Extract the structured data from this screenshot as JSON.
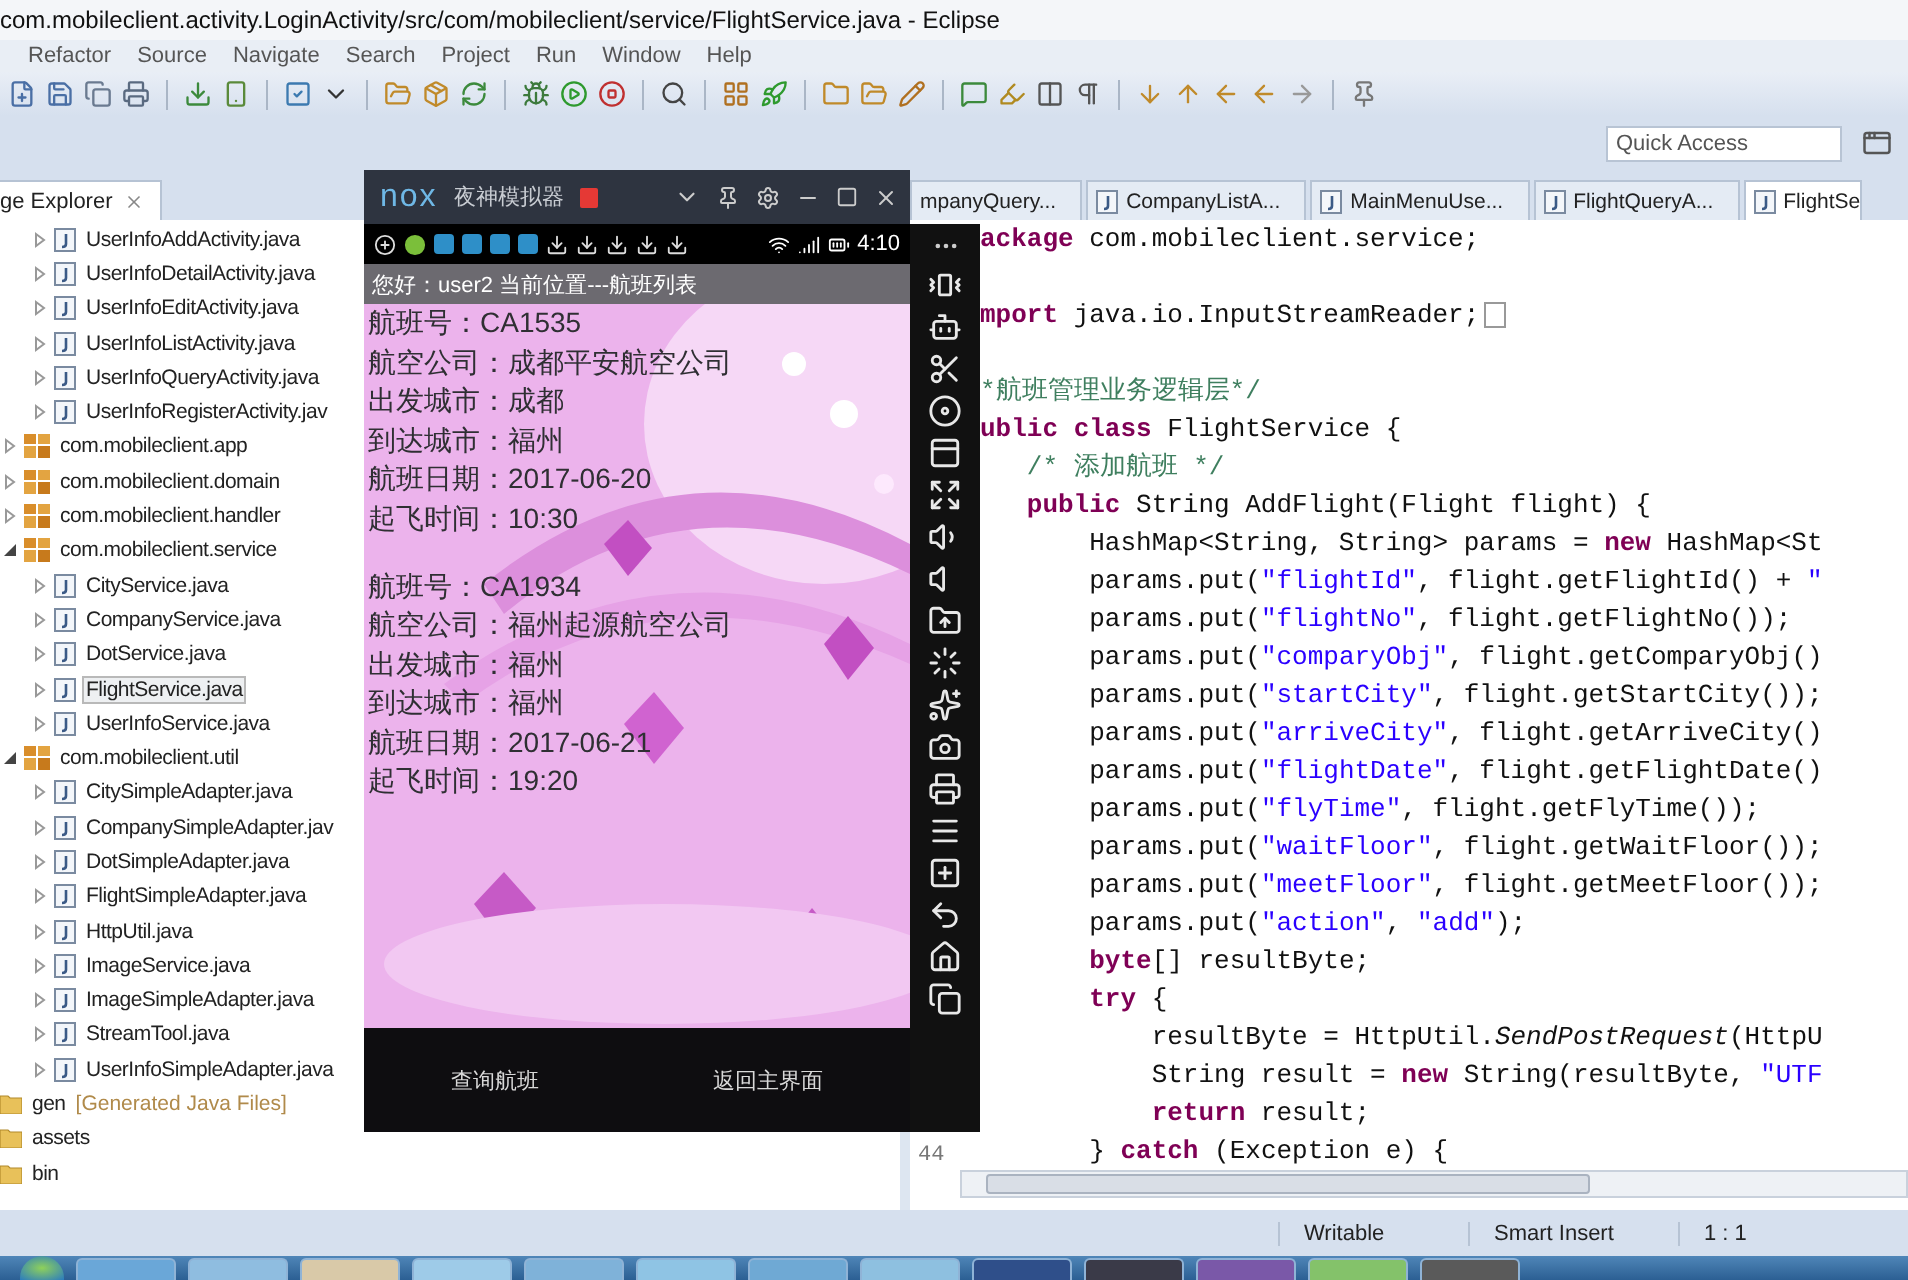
{
  "window": {
    "title": "com.mobileclient.activity.LoginActivity/src/com/mobileclient/service/FlightService.java - Eclipse"
  },
  "menu": [
    "Refactor",
    "Source",
    "Navigate",
    "Search",
    "Project",
    "Run",
    "Window",
    "Help"
  ],
  "quick_access": {
    "placeholder": "Quick Access"
  },
  "package_explorer": {
    "title": "ge Explorer",
    "tree": [
      {
        "label": "UserInfoAddActivity.java",
        "kind": "file",
        "selected": false
      },
      {
        "label": "UserInfoDetailActivity.java",
        "kind": "file",
        "selected": false
      },
      {
        "label": "UserInfoEditActivity.java",
        "kind": "file",
        "selected": false
      },
      {
        "label": "UserInfoListActivity.java",
        "kind": "file",
        "selected": false
      },
      {
        "label": "UserInfoQueryActivity.java",
        "kind": "file",
        "selected": false
      },
      {
        "label": "UserInfoRegisterActivity.jav",
        "kind": "file",
        "selected": false
      },
      {
        "label": "com.mobileclient.app",
        "kind": "package",
        "expanded": false,
        "selected": false
      },
      {
        "label": "com.mobileclient.domain",
        "kind": "package",
        "expanded": false,
        "selected": false
      },
      {
        "label": "com.mobileclient.handler",
        "kind": "package",
        "expanded": false,
        "selected": false
      },
      {
        "label": "com.mobileclient.service",
        "kind": "package",
        "expanded": true,
        "selected": false,
        "children": [
          {
            "label": "CityService.java",
            "kind": "file",
            "selected": false
          },
          {
            "label": "CompanyService.java",
            "kind": "file",
            "selected": false
          },
          {
            "label": "DotService.java",
            "kind": "file",
            "selected": false
          },
          {
            "label": "FlightService.java",
            "kind": "file",
            "selected": true
          },
          {
            "label": "UserInfoService.java",
            "kind": "file",
            "selected": false
          }
        ]
      },
      {
        "label": "com.mobileclient.util",
        "kind": "package",
        "expanded": true,
        "selected": false,
        "children": [
          {
            "label": "CitySimpleAdapter.java",
            "kind": "file",
            "selected": false
          },
          {
            "label": "CompanySimpleAdapter.jav",
            "kind": "file",
            "selected": false
          },
          {
            "label": "DotSimpleAdapter.java",
            "kind": "file",
            "selected": false
          },
          {
            "label": "FlightSimpleAdapter.java",
            "kind": "file",
            "selected": false
          },
          {
            "label": "HttpUtil.java",
            "kind": "file",
            "selected": false
          },
          {
            "label": "ImageService.java",
            "kind": "file",
            "selected": false
          },
          {
            "label": "ImageSimpleAdapter.java",
            "kind": "file",
            "selected": false
          },
          {
            "label": "StreamTool.java",
            "kind": "file",
            "selected": false
          },
          {
            "label": "UserInfoSimpleAdapter.java",
            "kind": "file",
            "selected": false
          }
        ]
      },
      {
        "label": "gen",
        "kind": "folder",
        "note": "[Generated Java Files]",
        "selected": false
      },
      {
        "label": "assets",
        "kind": "folder",
        "selected": false
      },
      {
        "label": "bin",
        "kind": "folder",
        "selected": false
      }
    ]
  },
  "editor": {
    "tabs": [
      {
        "label": "mpanyQuery...",
        "selected": false
      },
      {
        "label": "CompanyListA...",
        "selected": false
      },
      {
        "label": "MainMenuUse...",
        "selected": false
      },
      {
        "label": "FlightQueryA...",
        "selected": false
      },
      {
        "label": "FlightSe",
        "selected": true
      }
    ],
    "line_number": "44",
    "lines": [
      {
        "kind": "code",
        "segments": [
          {
            "kind": "keyword",
            "text": "ackage"
          },
          {
            "kind": "plain",
            "text": " com.mobileclient.service;"
          }
        ]
      },
      {
        "kind": "blank"
      },
      {
        "kind": "folded",
        "segments": [
          {
            "kind": "keyword",
            "text": "mport"
          },
          {
            "kind": "plain",
            "text": " java.io.InputStreamReader;"
          }
        ]
      },
      {
        "kind": "blank"
      },
      {
        "kind": "code",
        "segments": [
          {
            "kind": "comment",
            "text": "*航班管理业务逻辑层*/"
          }
        ]
      },
      {
        "kind": "code",
        "segments": [
          {
            "kind": "keyword",
            "text": "ublic"
          },
          {
            "kind": "keyword",
            "text": " class"
          },
          {
            "kind": "plain",
            "text": " FlightService {"
          }
        ]
      },
      {
        "kind": "code",
        "segments": [
          {
            "kind": "comment",
            "text": "   /* 添加航班 */"
          }
        ]
      },
      {
        "kind": "code",
        "segments": [
          {
            "kind": "keyword",
            "text": "   public"
          },
          {
            "kind": "plain",
            "text": " String AddFlight(Flight flight) {"
          }
        ]
      },
      {
        "kind": "code",
        "segments": [
          {
            "kind": "plain",
            "text": "       HashMap<String, String> params = "
          },
          {
            "kind": "keyword",
            "text": "new"
          },
          {
            "kind": "plain",
            "text": " HashMap<St"
          }
        ]
      },
      {
        "kind": "code",
        "segments": [
          {
            "kind": "plain",
            "text": "       params.put("
          },
          {
            "kind": "string",
            "text": "\"flightId\""
          },
          {
            "kind": "plain",
            "text": ", flight.getFlightId() + "
          },
          {
            "kind": "string",
            "text": "\""
          }
        ]
      },
      {
        "kind": "code",
        "segments": [
          {
            "kind": "plain",
            "text": "       params.put("
          },
          {
            "kind": "string",
            "text": "\"flightNo\""
          },
          {
            "kind": "plain",
            "text": ", flight.getFlightNo());"
          }
        ]
      },
      {
        "kind": "code",
        "segments": [
          {
            "kind": "plain",
            "text": "       params.put("
          },
          {
            "kind": "string",
            "text": "\"comparyObj\""
          },
          {
            "kind": "plain",
            "text": ", flight.getComparyObj()"
          }
        ]
      },
      {
        "kind": "code",
        "segments": [
          {
            "kind": "plain",
            "text": "       params.put("
          },
          {
            "kind": "string",
            "text": "\"startCity\""
          },
          {
            "kind": "plain",
            "text": ", flight.getStartCity());"
          }
        ]
      },
      {
        "kind": "code",
        "segments": [
          {
            "kind": "plain",
            "text": "       params.put("
          },
          {
            "kind": "string",
            "text": "\"arriveCity\""
          },
          {
            "kind": "plain",
            "text": ", flight.getArriveCity()"
          }
        ]
      },
      {
        "kind": "code",
        "segments": [
          {
            "kind": "plain",
            "text": "       params.put("
          },
          {
            "kind": "string",
            "text": "\"flightDate\""
          },
          {
            "kind": "plain",
            "text": ", flight.getFlightDate()"
          }
        ]
      },
      {
        "kind": "code",
        "segments": [
          {
            "kind": "plain",
            "text": "       params.put("
          },
          {
            "kind": "string",
            "text": "\"flyTime\""
          },
          {
            "kind": "plain",
            "text": ", flight.getFlyTime());"
          }
        ]
      },
      {
        "kind": "code",
        "segments": [
          {
            "kind": "plain",
            "text": "       params.put("
          },
          {
            "kind": "string",
            "text": "\"waitFloor\""
          },
          {
            "kind": "plain",
            "text": ", flight.getWaitFloor());"
          }
        ]
      },
      {
        "kind": "code",
        "segments": [
          {
            "kind": "plain",
            "text": "       params.put("
          },
          {
            "kind": "string",
            "text": "\"meetFloor\""
          },
          {
            "kind": "plain",
            "text": ", flight.getMeetFloor());"
          }
        ]
      },
      {
        "kind": "code",
        "segments": [
          {
            "kind": "plain",
            "text": "       params.put("
          },
          {
            "kind": "string",
            "text": "\"action\""
          },
          {
            "kind": "plain",
            "text": ", "
          },
          {
            "kind": "string",
            "text": "\"add\""
          },
          {
            "kind": "plain",
            "text": ");"
          }
        ]
      },
      {
        "kind": "code",
        "segments": [
          {
            "kind": "keyword",
            "text": "       byte"
          },
          {
            "kind": "plain",
            "text": "[] resultByte;"
          }
        ]
      },
      {
        "kind": "code",
        "segments": [
          {
            "kind": "keyword",
            "text": "       try"
          },
          {
            "kind": "plain",
            "text": " {"
          }
        ]
      },
      {
        "kind": "code",
        "segments": [
          {
            "kind": "plain",
            "text": "           resultByte = HttpUtil."
          },
          {
            "kind": "italic",
            "text": "SendPostRequest"
          },
          {
            "kind": "plain",
            "text": "(HttpU"
          }
        ]
      },
      {
        "kind": "code",
        "segments": [
          {
            "kind": "plain",
            "text": "           String result = "
          },
          {
            "kind": "keyword",
            "text": "new"
          },
          {
            "kind": "plain",
            "text": " String(resultByte, "
          },
          {
            "kind": "string",
            "text": "\"UTF"
          }
        ]
      },
      {
        "kind": "code",
        "segments": [
          {
            "kind": "keyword",
            "text": "           return"
          },
          {
            "kind": "plain",
            "text": " result;"
          }
        ]
      },
      {
        "kind": "code",
        "segments": [
          {
            "kind": "plain",
            "text": "       } "
          },
          {
            "kind": "keyword",
            "text": "catch"
          },
          {
            "kind": "plain",
            "text": " (Exception e) {"
          }
        ]
      }
    ]
  },
  "emulator": {
    "logo": "nox",
    "title": "夜神模拟器",
    "clock": "4:10",
    "header": "您好：user2 当前位置---航班列表",
    "flights": [
      {
        "lines": [
          "航班号：CA1535",
          "航空公司：成都平安航空公司",
          "出发城市：成都",
          "到达城市：福州",
          "航班日期：2017-06-20",
          "起飞时间：10:30"
        ]
      },
      {
        "lines": [
          "航班号：CA1934",
          "航空公司：福州起源航空公司",
          "出发城市：福州",
          "到达城市：福州",
          "航班日期：2017-06-21",
          "起飞时间：19:20"
        ]
      }
    ],
    "buttons": [
      "查询航班",
      "返回主界面"
    ]
  },
  "status_bar": [
    "Writable",
    "Smart Insert",
    "1 : 1"
  ]
}
